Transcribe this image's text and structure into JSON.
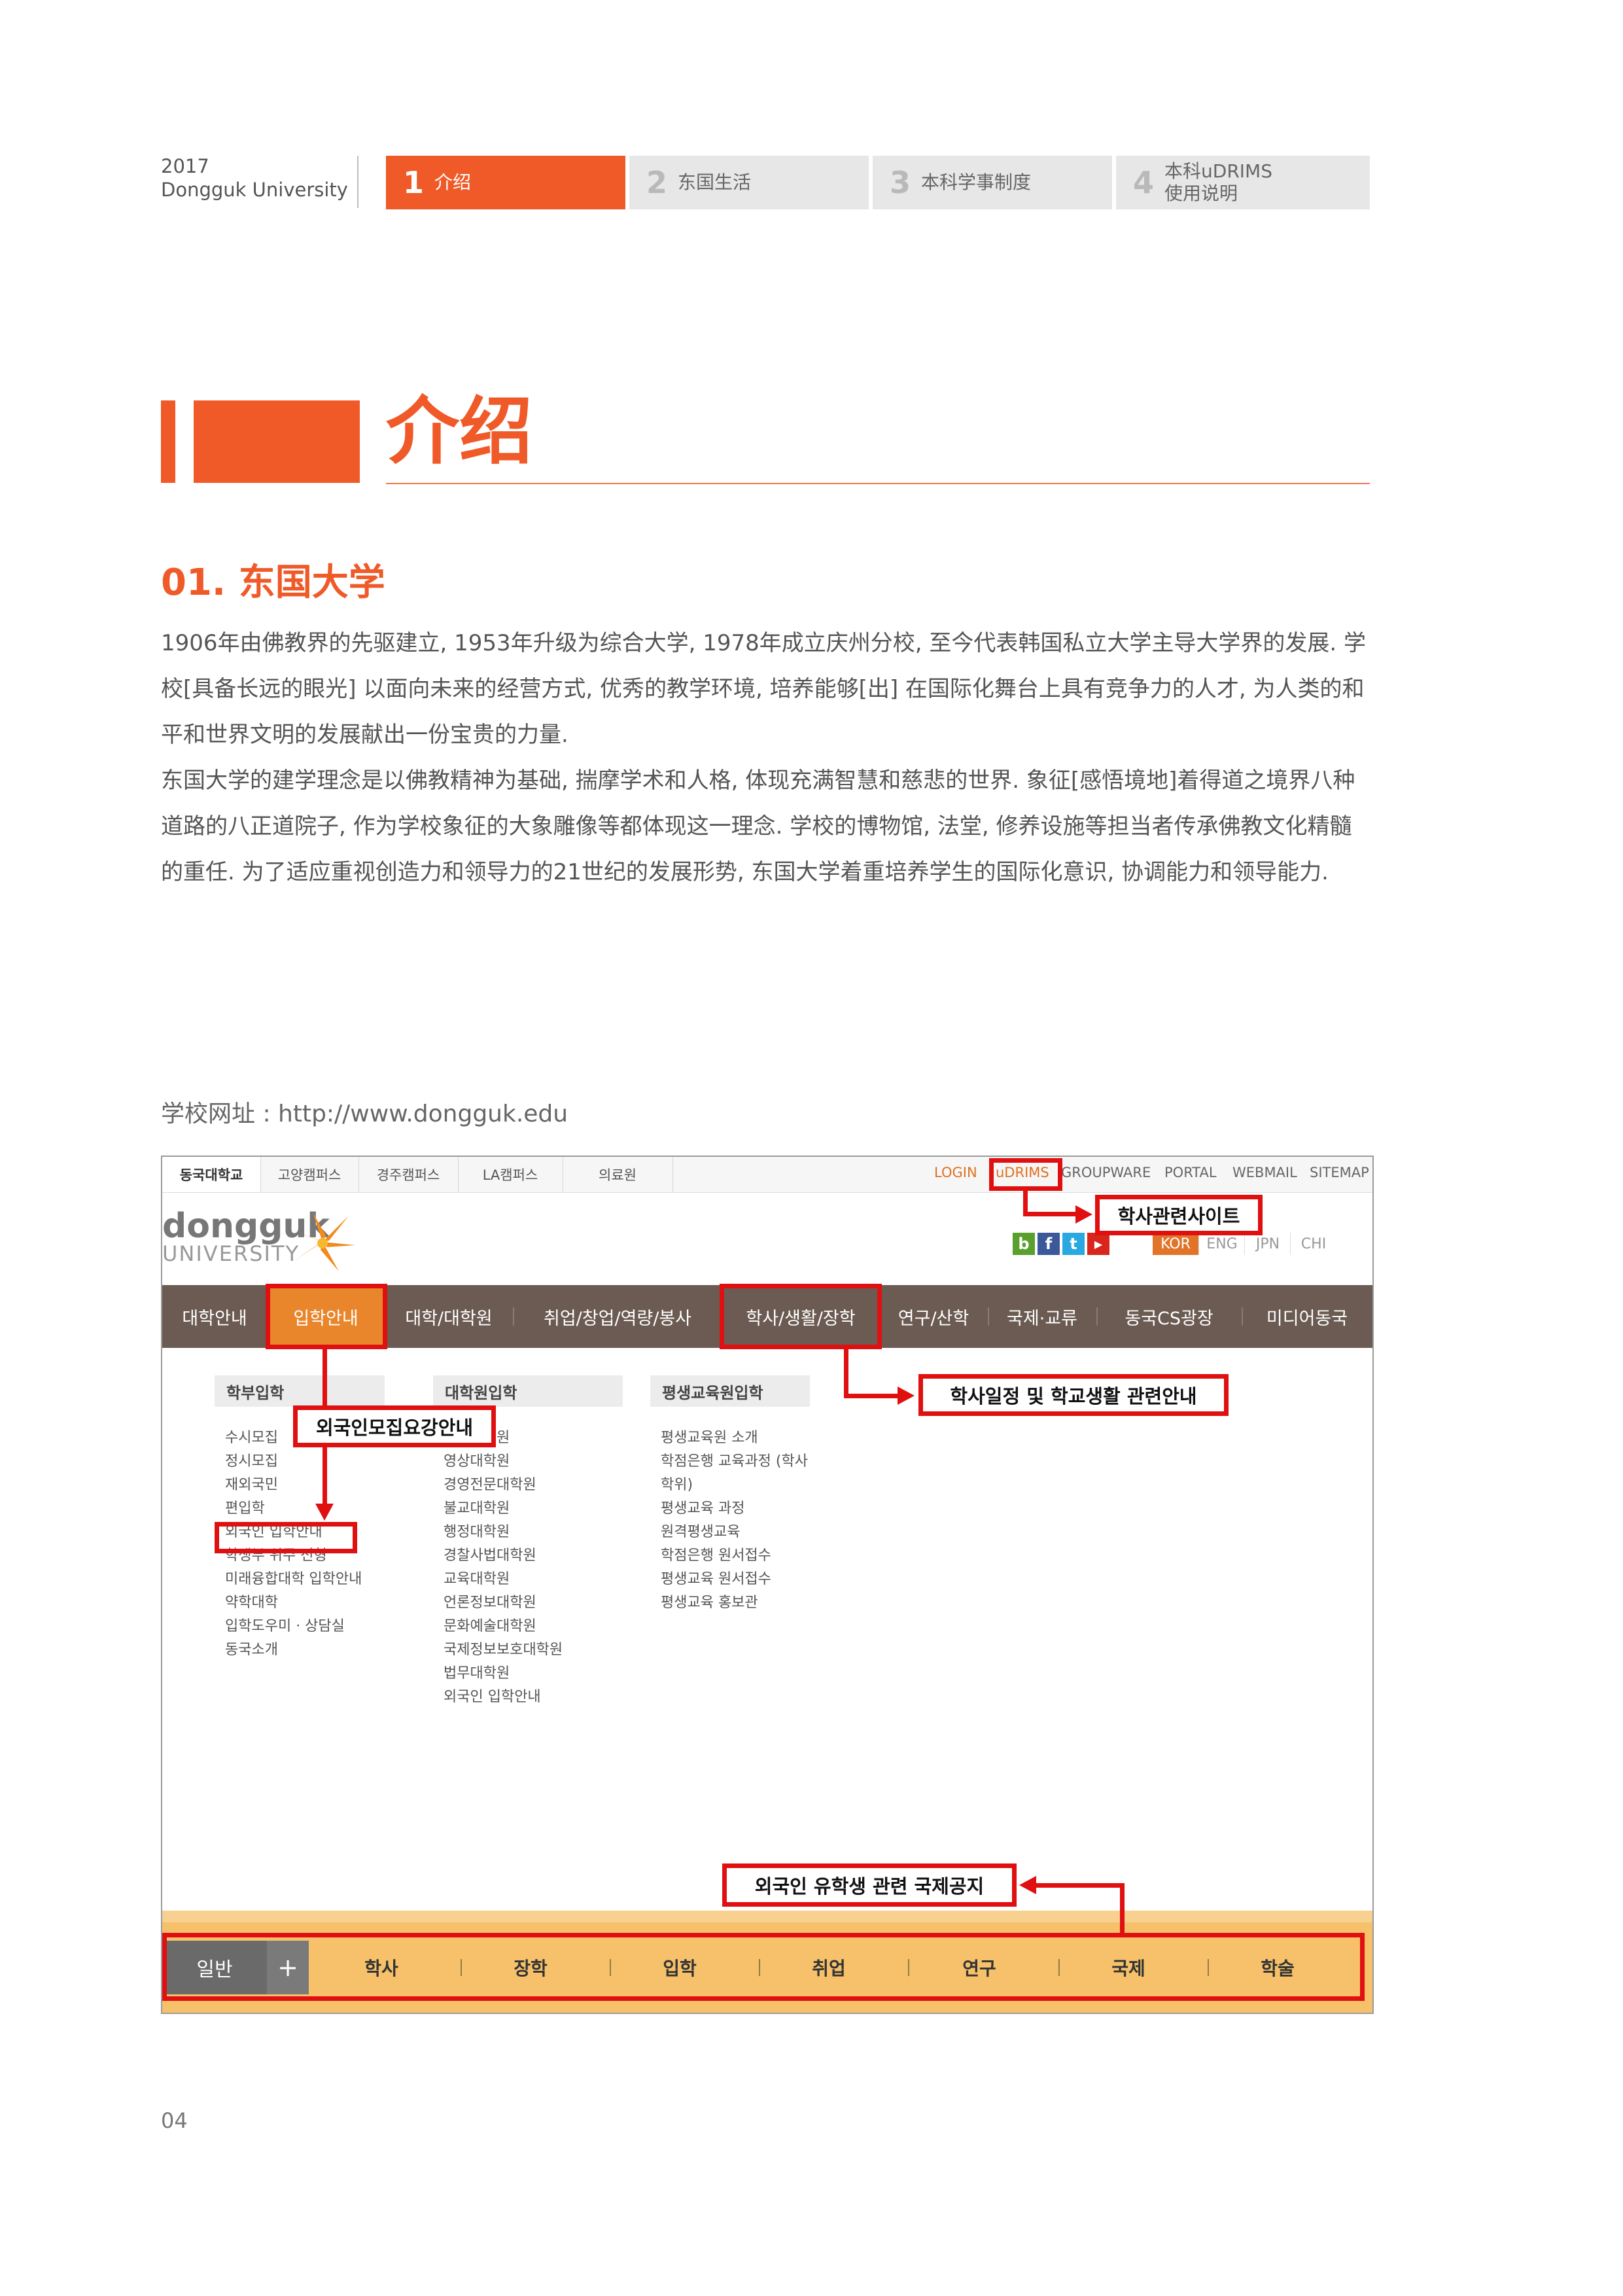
{
  "header": {
    "year": "2017",
    "university": "Dongguk University",
    "tabs": [
      {
        "num": "1",
        "label": "介绍"
      },
      {
        "num": "2",
        "label": "东国生活"
      },
      {
        "num": "3",
        "label": "本科学事制度"
      },
      {
        "num": "4",
        "label": "本科uDRIMS\n使用说明"
      }
    ]
  },
  "chapter": {
    "title": "介绍"
  },
  "section": {
    "title": "01. 东国大学",
    "paragraphs": [
      "1906年由佛教界的先驱建立, 1953年升级为综合大学, 1978年成立庆州分校, 至今代表韩国私立大学主导大学界的发展. 学校[具备长远的眼光] 以面向未来的经营方式, 优秀的教学环境, 培养能够[出] 在国际化舞台上具有竞争力的人才, 为人类的和平和世界文明的发展献出一份宝贵的力量.",
      "东国大学的建学理念是以佛教精神为基础, 揣摩学术和人格, 体现充满智慧和慈悲的世界. 象征[感悟境地]着得道之境界八种道路的八正道院子, 作为学校象征的大象雕像等都体现这一理念. 学校的博物馆, 法堂, 修养设施等担当者传承佛教文化精髓的重任. 为了适应重视创造力和领导力的21世纪的发展形势, 东国大学着重培养学生的国际化意识, 协调能力和领导能力."
    ],
    "url_line": "学校网址 : http://www.dongguk.edu"
  },
  "website": {
    "top_tabs": [
      "동국대학교",
      "고양캠퍼스",
      "경주캠퍼스",
      "LA캠퍼스",
      "의료원"
    ],
    "top_links": [
      "LOGIN",
      "uDRIMS",
      "GROUPWARE",
      "PORTAL",
      "WEBMAIL",
      "SITEMAP"
    ],
    "logo_main": "dongguk",
    "logo_sub": "UNIVERSITY",
    "social": [
      "b",
      "f",
      "t",
      "▶"
    ],
    "languages": [
      "KOR",
      "ENG",
      "JPN",
      "CHI"
    ],
    "main_nav": [
      "대학안내",
      "입학안내",
      "대학/대학원",
      "취업/창업/역량/봉사",
      "학사/생활/장학",
      "연구/산학",
      "국제·교류",
      "동국CS광장",
      "미디어동국"
    ],
    "columns": [
      {
        "head": "학부입학",
        "items": [
          "수시모집",
          "정시모집",
          "재외국민",
          "편입학",
          "외국인 입학안내",
          "학생부 위주 전형",
          "미래융합대학 입학안내",
          "약학대학",
          "입학도우미 · 상담실",
          "동국소개"
        ]
      },
      {
        "head": "대학원입학",
        "items": [
          "일반대학원",
          "영상대학원",
          "경영전문대학원",
          "불교대학원",
          "행정대학원",
          "경찰사법대학원",
          "교육대학원",
          "언론정보대학원",
          "문화예술대학원",
          "국제정보보호대학원",
          "법무대학원",
          "외국인 입학안내"
        ]
      },
      {
        "head": "평생교육원입학",
        "items": [
          "평생교육원 소개",
          "학점은행 교육과정 (학사",
          "학위)",
          "평생교육 과정",
          "원격평생교육",
          "학점은행 원서접수",
          "평생교육 원서접수",
          "평생교육 홍보관"
        ]
      }
    ],
    "bottom_bar": {
      "general": "일반",
      "plus": "+",
      "items": [
        "학사",
        "장학",
        "입학",
        "취업",
        "연구",
        "국제",
        "학술"
      ]
    },
    "annotations": {
      "academic_sites": "학사관련사이트",
      "foreigner_guide": "외국인모집요강안내",
      "schedule_guide": "학사일정 및 학교생활 관련안내",
      "intl_notice": "외국인 유학생 관련 국제공지"
    }
  },
  "page_number": "04",
  "colors": {
    "accent": "#ef5a28",
    "nav_brown": "#6b5b52",
    "nav_active": "#e9862c",
    "annotation_red": "#e01010",
    "bottom_bar": "#f6c16a"
  }
}
